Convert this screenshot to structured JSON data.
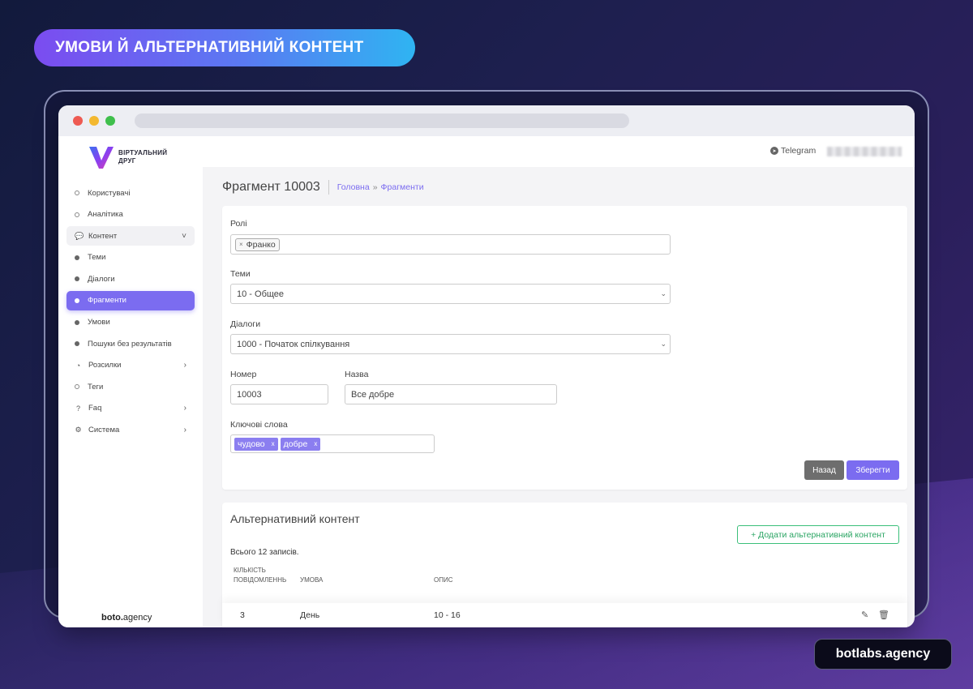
{
  "banner": {
    "title": "УМОВИ Й АЛЬТЕРНАТИВНИЙ КОНТЕНТ"
  },
  "footer_badge": {
    "text": "botlabs.agency"
  },
  "app": {
    "logo": {
      "line1": "ВІРТУАЛЬНИЙ",
      "line2": "ДРУГ"
    },
    "sidebar": {
      "items": [
        {
          "label": "Користувачі",
          "icon": "circle-hollow-icon"
        },
        {
          "label": "Аналітика",
          "icon": "circle-hollow-icon"
        },
        {
          "label": "Контент",
          "icon": "comment-icon",
          "chevron": "˅"
        },
        {
          "label": "Теми",
          "icon": "bullet-icon"
        },
        {
          "label": "Діалоги",
          "icon": "bullet-icon"
        },
        {
          "label": "Фрагменти",
          "icon": "bullet-icon",
          "active": true
        },
        {
          "label": "Умови",
          "icon": "bullet-icon"
        },
        {
          "label": "Пошуки без результатів",
          "icon": "bullet-icon"
        },
        {
          "label": "Розсилки",
          "icon": "broadcast-icon",
          "chevron": "›"
        },
        {
          "label": "Теги",
          "icon": "circle-hollow-icon"
        },
        {
          "label": "Faq",
          "icon": "question-icon",
          "chevron": "›"
        },
        {
          "label": "Система",
          "icon": "gears-icon",
          "chevron": "›"
        }
      ],
      "footer_bold": "boto.",
      "footer_rest": "agency"
    },
    "topbar": {
      "telegram_label": "Telegram"
    },
    "page": {
      "title": "Фрагмент 10003",
      "breadcrumb": [
        "Головна",
        "»",
        "Фрагменти"
      ]
    },
    "form": {
      "roles_label": "Ролі",
      "roles_value": "Франко",
      "roles_remove": "×",
      "themes_label": "Теми",
      "themes_value": "10 - Общее",
      "dialogs_label": "Діалоги",
      "dialogs_value": "1000 - Початок спілкування",
      "number_label": "Номер",
      "number_value": "10003",
      "name_label": "Назва",
      "name_value": "Все добре",
      "keywords_label": "Ключові слова",
      "keywords": [
        "чудово",
        "добре"
      ],
      "keyword_remove": "x",
      "back_button": "Назад",
      "save_button": "Зберегти"
    },
    "alt_content": {
      "title": "Альтернативний контент",
      "add_button": "+ Додати альтернативний контент",
      "total": "Всього 12 записів.",
      "columns": [
        "КІЛЬКІСТЬ ПОВІДОМЛЕННЬ",
        "УМОВА",
        "ОПИС"
      ],
      "col0_line1": "КІЛЬКІСТЬ",
      "col0_line2": "ПОВІДОМЛЕННЬ",
      "rows": [
        {
          "count": "3",
          "condition": "День",
          "description": "10 - 16"
        }
      ]
    }
  },
  "colors": {
    "accent": "#7b6cf0",
    "success": "#2aa563",
    "back_button": "#6e6e6e"
  }
}
